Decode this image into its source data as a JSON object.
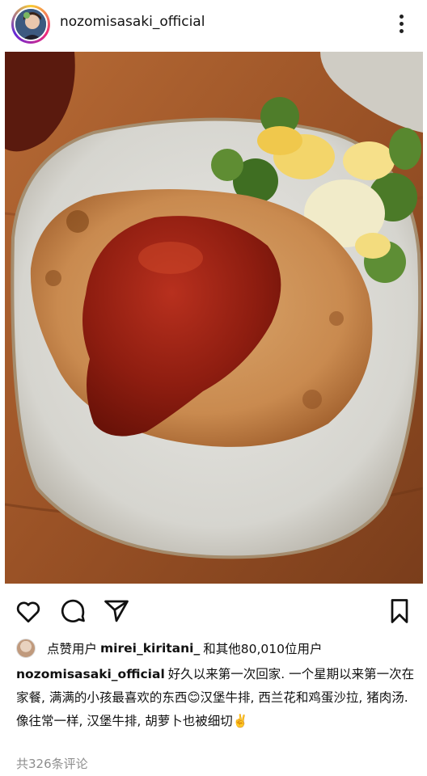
{
  "post": {
    "username": "nozomisasaki_official"
  },
  "likes": {
    "prefix": "点赞用户",
    "user": "mirei_kiritani_",
    "suffix": "和其他80,010位用户"
  },
  "caption": {
    "username": "nozomisasaki_official",
    "text": "好久以来第一次回家. 一个星期以来第一次在家餐, 满满的小孩最喜欢的东西😊汉堡牛排, 西兰花和鸡蛋沙拉, 猪肉汤. 像往常一样, 汉堡牛排, 胡萝卜也被细切✌️"
  },
  "comments": {
    "label": "共326条评论"
  },
  "icons": {
    "more": "more-vertical-icon",
    "like": "heart-icon",
    "comment": "comment-icon",
    "share": "send-icon",
    "save": "bookmark-icon"
  }
}
